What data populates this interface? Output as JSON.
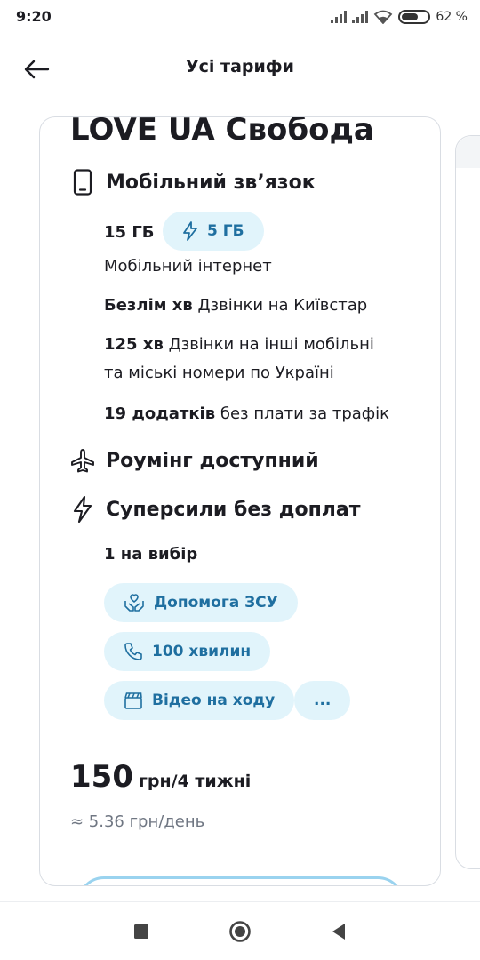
{
  "status": {
    "time": "9:20",
    "battery": "62 %",
    "battery_level": 0.62
  },
  "header": {
    "title": "Усі тарифи"
  },
  "plan": {
    "title": "LOVE UA Свобода",
    "mobile": {
      "title": "Мобільний зв’язок",
      "data_amount": "15 ГБ",
      "bonus_chip": "5 ГБ",
      "data_label": "Мобільний інтернет",
      "calls_kyivstar_bold": "Безлім хв",
      "calls_kyivstar_text": " Дзвінки на Київстар",
      "calls_other_bold": "125 хв",
      "calls_other_text_1": " Дзвінки на інші мобільні",
      "calls_other_text_2": "та міські номери по Україні",
      "apps_bold": "19 додатків",
      "apps_text": " без плати за трафік"
    },
    "roaming": {
      "title": "Роумінг доступний"
    },
    "superpowers": {
      "title": "Суперсили без доплат",
      "choice": "1 на вибір",
      "options": [
        "Допомога ЗСУ",
        "100 хвилин",
        "Відео на ходу",
        "..."
      ]
    },
    "price": {
      "value": "150",
      "unit": "грн/4 тижні",
      "per_day": "≈ 5.36 грн/день"
    }
  },
  "colors": {
    "accent": "#1f6fa0",
    "chip_bg": "#e1f4fb",
    "cta_border": "#9ad3ef"
  }
}
